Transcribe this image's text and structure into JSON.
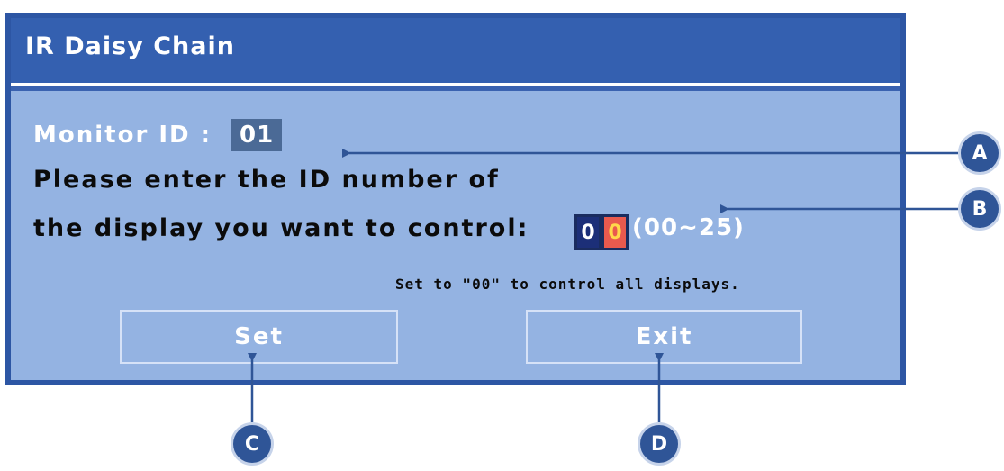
{
  "dialog": {
    "title": "IR Daisy Chain",
    "monitor_id_label": "Monitor ID :",
    "monitor_id_value": "01",
    "prompt_line1": "Please enter the ID number of",
    "prompt_line2": "the display you want to control:",
    "id_digits": [
      "0",
      "0"
    ],
    "id_range": "(00~25)",
    "hint": "Set to \"00\" to control all displays.",
    "set_button": "Set",
    "exit_button": "Exit"
  },
  "callouts": {
    "a": "A",
    "b": "B",
    "c": "C",
    "d": "D"
  },
  "colors": {
    "panel": "#94b3e2",
    "title_bar": "#3460b0",
    "border": "#2d56a4",
    "digit_selected": "#e95a4e",
    "digit_normal": "#1c2f78",
    "callout": "#2f5597"
  }
}
